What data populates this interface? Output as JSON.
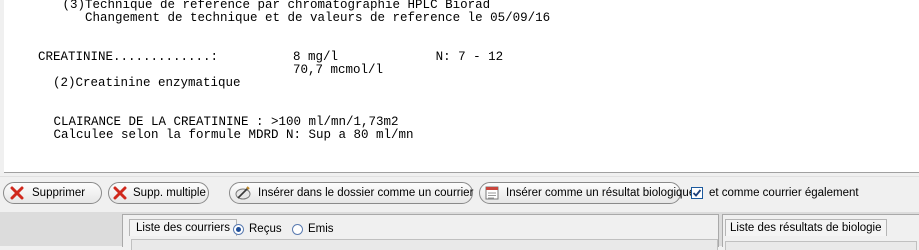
{
  "report": {
    "lines": [
      "   (3)Technique de reference par chromatographie HPLC Biorad",
      "      Changement de technique et de valeurs de reference le 05/09/16",
      "CREATININE.............:          8 mg/l             N: 7 - 12",
      "                                  70,7 mcmol/l",
      "  (2)Creatinine enzymatique",
      "   CLAIRANCE DE LA CREATININE : >100 ml/mn/1,73m2",
      "   Calculee selon la formule MDRD N: Sup a 80 ml/mn"
    ]
  },
  "toolbar": {
    "delete_label": "Supprimer",
    "multi_delete_label": "Supp. multiple",
    "insert_letter_label": "Insérer dans le dossier comme un courrier",
    "insert_result_label": "Insérer comme un résultat biologique",
    "also_letter_label": "et comme courrier également",
    "also_letter_checked": true
  },
  "letters_panel": {
    "tab_label": "Liste des courriers",
    "radio_received_label": "Reçus",
    "radio_sent_label": "Emis",
    "selected": "Reçus"
  },
  "results_panel": {
    "tab_label": "Liste des résultats de biologie"
  },
  "icons": {
    "delete": "red-x-icon",
    "multi_delete": "red-x-icon",
    "insert_letter": "pen-letter-icon",
    "insert_result": "lab-form-icon"
  },
  "colors": {
    "delete_red": "#d0281c",
    "checkbox_blue": "#1c5a9e"
  }
}
